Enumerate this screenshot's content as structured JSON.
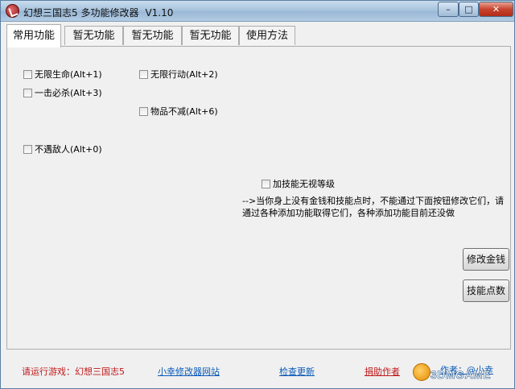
{
  "window": {
    "title": "幻想三国志5 多功能修改器",
    "version": "V1.10",
    "minimize_label": "–",
    "maximize_label": "□",
    "close_label": "✕"
  },
  "tabs": [
    {
      "label": "常用功能",
      "active": true
    },
    {
      "label": "暂无功能",
      "active": false
    },
    {
      "label": "暂无功能",
      "active": false
    },
    {
      "label": "暂无功能",
      "active": false
    },
    {
      "label": "使用方法",
      "active": false
    }
  ],
  "options": {
    "infinite_hp": "无限生命(Alt+1)",
    "infinite_action": "无限行动(Alt+2)",
    "one_hit_kill": "一击必杀(Alt+3)",
    "items_unlimited": "物品不减(Alt+6)",
    "no_encounter": "不遇敌人(Alt+0)",
    "skill_ignore_level": "加技能无视等级"
  },
  "note": "-->当你身上没有金钱和技能点时，不能通过下面按钮修改它们，请通过各种添加功能取得它们，各种添加功能目前还没做",
  "buttons": {
    "edit_money": "修改金钱",
    "skill_points": "技能点数"
  },
  "status": {
    "run_game": "请运行游戏：幻想三国志5",
    "site_link": "小幸修改器网站",
    "check_update": "检查更新",
    "donate": "捐助作者",
    "author": "作者：@小幸"
  },
  "brand": {
    "text": "3DMGAME"
  }
}
